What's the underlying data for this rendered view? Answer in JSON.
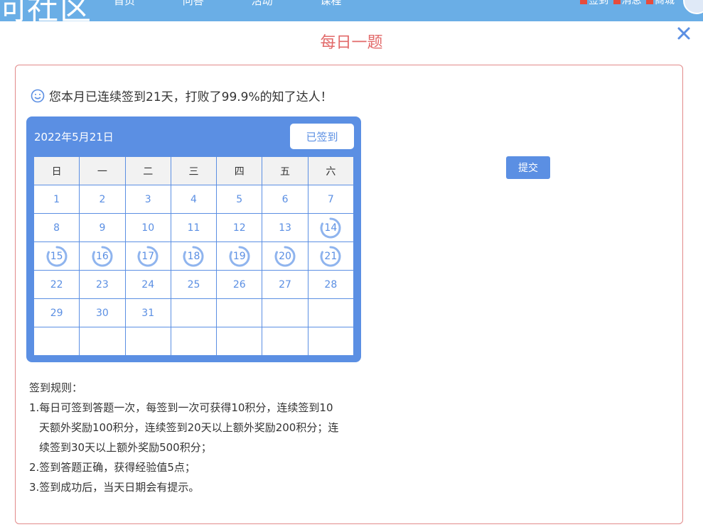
{
  "topbar": {
    "brand": "问社区",
    "nav": [
      "首页",
      "问答",
      "活动",
      "课程"
    ],
    "user_items": [
      "签到",
      "消息",
      "商城"
    ]
  },
  "modal": {
    "title": "每日一题",
    "greeting": "您本月已连续签到21天，打败了99.9%的知了达人！",
    "submit_label": "提交"
  },
  "calendar": {
    "date_label": "2022年5月21日",
    "signed_label": "已签到",
    "weekdays": [
      "日",
      "一",
      "二",
      "三",
      "四",
      "五",
      "六"
    ],
    "first_weekday_offset": 0,
    "days_in_month": 31,
    "signed_days": [
      14,
      15,
      16,
      17,
      18,
      19,
      20,
      21
    ],
    "colors": {
      "accent": "#5b8fe3",
      "ring": "#8fb4ee"
    }
  },
  "rules": {
    "heading": "签到规则：",
    "items": [
      "1.每日可签到答题一次，每签到一次可获得10积分，连续签到10",
      "天额外奖励100积分，连续签到20天以上额外奖励200积分；连",
      "续签到30天以上额外奖励500积分；",
      "2.签到答题正确，获得经验值5点；",
      "3.签到成功后，当天日期会有提示。"
    ]
  }
}
